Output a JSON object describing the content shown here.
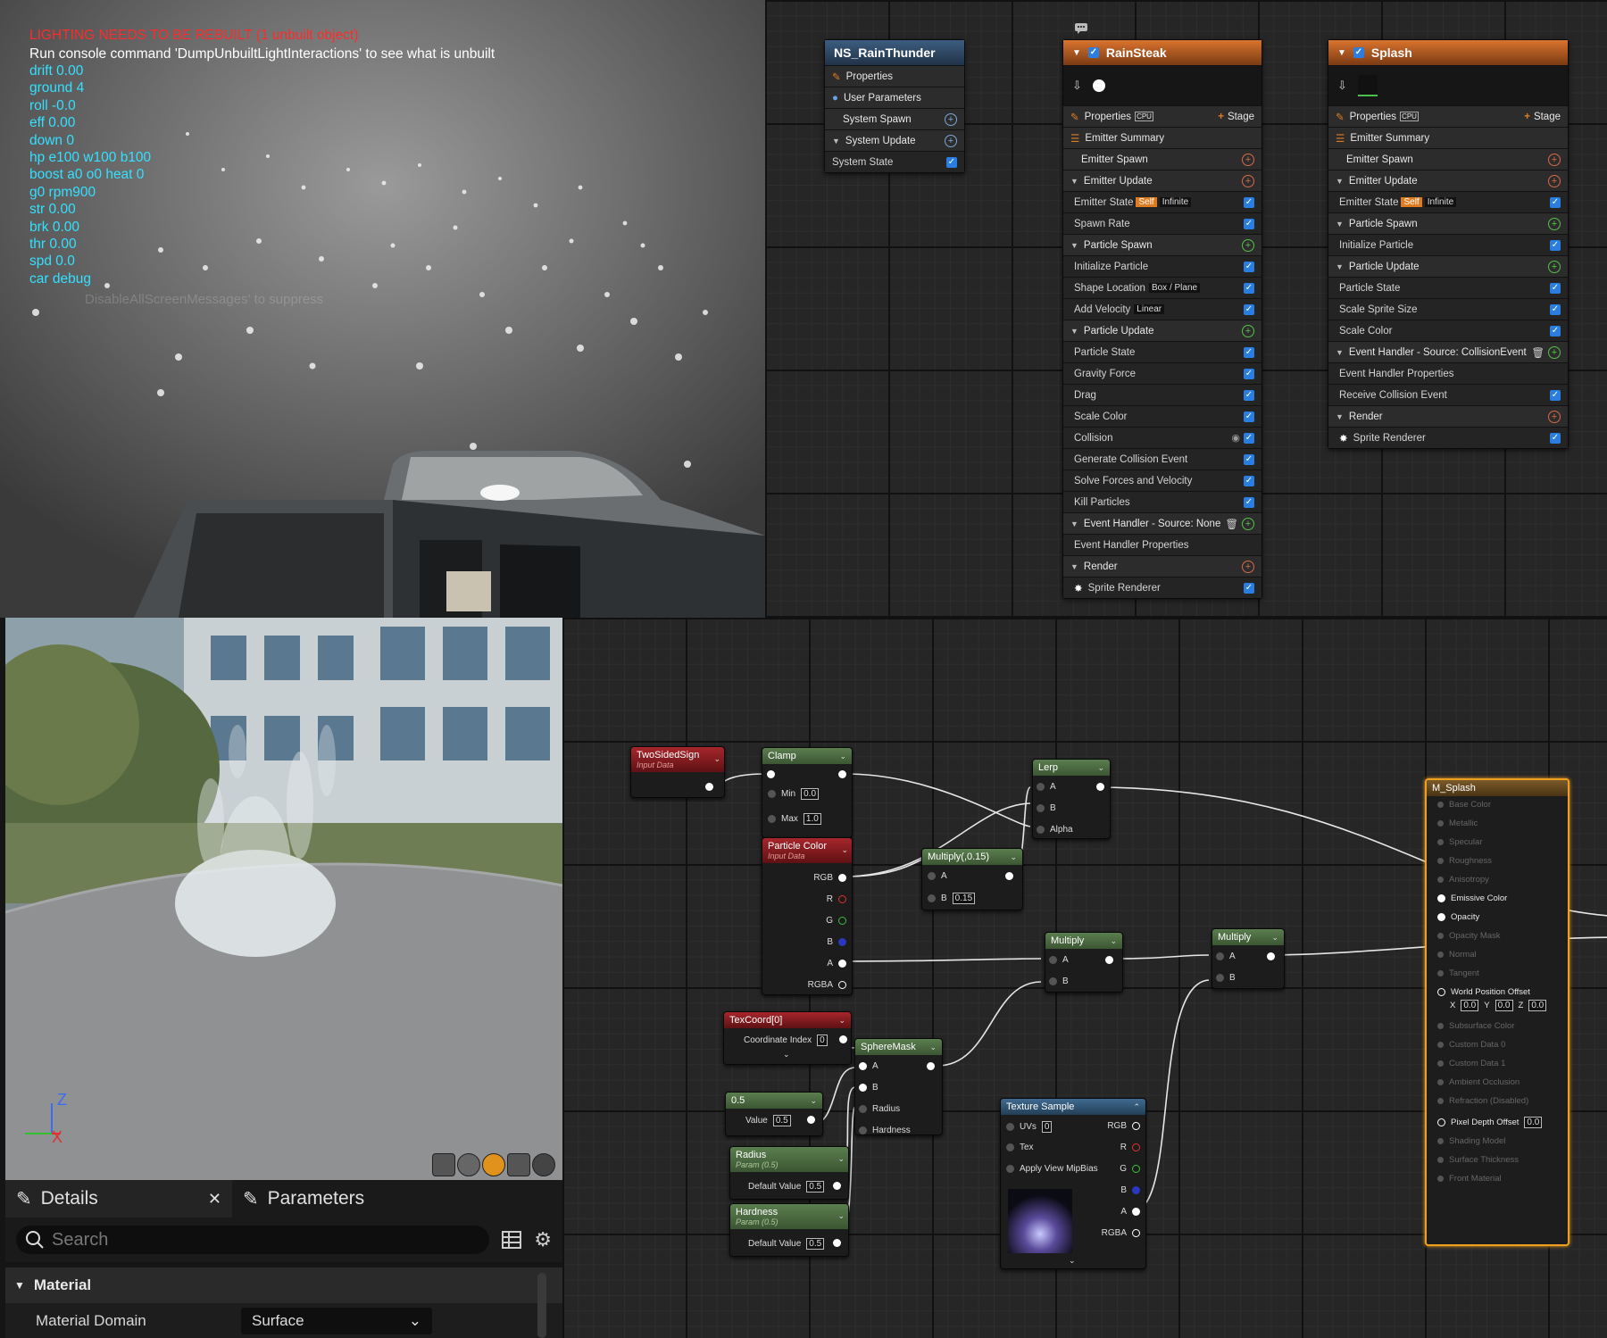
{
  "viewport_top": {
    "red_line": "LIGHTING NEEDS TO BE REBUILT (1 unbuilt object)",
    "white_line": "Run console command 'DumpUnbuiltLightInteractions' to see what is unbuilt",
    "debug_lines": [
      "drift 0.00",
      "ground 4",
      "roll -0.0",
      "eff 0.00",
      "down 0",
      "hp e100 w100 b100",
      "boost a0 o0 heat 0",
      "g0 rpm900",
      "str 0.00",
      "brk 0.00",
      "thr 0.00",
      "spd 0.0",
      "car debug"
    ],
    "ghost_text": "DisableAllScreenMessages' to suppress"
  },
  "niagara": {
    "system_node": {
      "title": "NS_RainThunder",
      "rows": [
        "Properties",
        "User Parameters",
        "System Spawn",
        "System Update",
        "System State"
      ]
    },
    "rainsteak": {
      "title": "RainSteak",
      "properties": "Properties",
      "cpu": "CPU",
      "stage": "Stage",
      "rows": [
        {
          "label": "Emitter Summary"
        },
        {
          "label": "Emitter Spawn"
        },
        {
          "label": "Emitter Update"
        },
        {
          "label": "Emitter State",
          "tag": "Self",
          "tag2": "Infinite"
        },
        {
          "label": "Spawn Rate"
        },
        {
          "label": "Particle Spawn"
        },
        {
          "label": "Initialize Particle"
        },
        {
          "label": "Shape Location",
          "tag2": "Box / Plane"
        },
        {
          "label": "Add Velocity",
          "tag2": "Linear"
        },
        {
          "label": "Particle Update"
        },
        {
          "label": "Particle State"
        },
        {
          "label": "Gravity Force"
        },
        {
          "label": "Drag"
        },
        {
          "label": "Scale Color"
        },
        {
          "label": "Collision"
        },
        {
          "label": "Generate Collision Event"
        },
        {
          "label": "Solve Forces and Velocity"
        },
        {
          "label": "Kill Particles"
        },
        {
          "label": "Event Handler - Source: None"
        },
        {
          "label": "Event Handler Properties"
        },
        {
          "label": "Render"
        },
        {
          "label": "Sprite Renderer"
        }
      ]
    },
    "splash": {
      "title": "Splash",
      "properties": "Properties",
      "cpu": "CPU",
      "stage": "Stage",
      "rows": [
        {
          "label": "Emitter Summary"
        },
        {
          "label": "Emitter Spawn"
        },
        {
          "label": "Emitter Update"
        },
        {
          "label": "Emitter State",
          "tag": "Self",
          "tag2": "Infinite"
        },
        {
          "label": "Particle Spawn"
        },
        {
          "label": "Initialize Particle"
        },
        {
          "label": "Particle Update"
        },
        {
          "label": "Particle State"
        },
        {
          "label": "Scale Sprite Size"
        },
        {
          "label": "Scale Color"
        },
        {
          "label": "Event Handler - Source: CollisionEvent"
        },
        {
          "label": "Event Handler Properties"
        },
        {
          "label": "Receive Collision Event"
        },
        {
          "label": "Render"
        },
        {
          "label": "Sprite Renderer"
        }
      ]
    }
  },
  "viewport_bottom": {
    "axis_z": "Z",
    "axis_x": "X"
  },
  "details": {
    "tab_details": "Details",
    "tab_parameters": "Parameters",
    "search_placeholder": "Search",
    "category": "Material",
    "prop_label": "Material Domain",
    "prop_value": "Surface"
  },
  "material": {
    "twosided": {
      "title": "TwoSidedSign",
      "sub": "Input Data"
    },
    "clamp": {
      "title": "Clamp",
      "min_label": "Min",
      "min": "0.0",
      "max_label": "Max",
      "max": "1.0"
    },
    "particlecolor": {
      "title": "Particle Color",
      "sub": "Input Data",
      "pins": [
        "RGB",
        "R",
        "G",
        "B",
        "A",
        "RGBA"
      ]
    },
    "lerp": {
      "title": "Lerp",
      "a": "A",
      "b": "B",
      "alpha": "Alpha"
    },
    "multiply015": {
      "title": "Multiply(,0.15)",
      "a": "A",
      "b": "B",
      "b_value": "0.15"
    },
    "multiply1": {
      "title": "Multiply",
      "a": "A",
      "b": "B"
    },
    "multiply2": {
      "title": "Multiply",
      "a": "A",
      "b": "B"
    },
    "texcoord": {
      "title": "TexCoord[0]",
      "label": "Coordinate Index",
      "value": "0"
    },
    "spheremask": {
      "title": "SphereMask",
      "a": "A",
      "b": "B",
      "radius": "Radius",
      "hardness": "Hardness"
    },
    "const05": {
      "title": "0.5",
      "label": "Value",
      "value": "0.5"
    },
    "radius": {
      "title": "Radius",
      "sub": "Param (0.5)",
      "label": "Default Value",
      "value": "0.5"
    },
    "hardness": {
      "title": "Hardness",
      "sub": "Param (0.5)",
      "label": "Default Value",
      "value": "0.5"
    },
    "texsample": {
      "title": "Texture Sample",
      "uvs": "UVs",
      "uvs_value": "0",
      "tex": "Tex",
      "mip": "Apply View MipBias",
      "outs": [
        "RGB",
        "R",
        "G",
        "B",
        "A",
        "RGBA"
      ]
    },
    "msplash": {
      "title": "M_Splash",
      "pins": [
        "Base Color",
        "Metallic",
        "Specular",
        "Roughness",
        "Anisotropy",
        "Emissive Color",
        "Opacity",
        "Opacity Mask",
        "Normal",
        "Tangent",
        "World Position Offset",
        "Subsurface Color",
        "Custom Data 0",
        "Custom Data 1",
        "Ambient Occlusion",
        "Refraction (Disabled)",
        "Pixel Depth Offset",
        "Shading Model",
        "Surface Thickness",
        "Front Material"
      ],
      "wpo_x": "0.0",
      "wpo_y": "0.0",
      "wpo_z": "0.0",
      "pdo": "0.0",
      "x": "X",
      "y": "Y",
      "z": "Z"
    }
  }
}
